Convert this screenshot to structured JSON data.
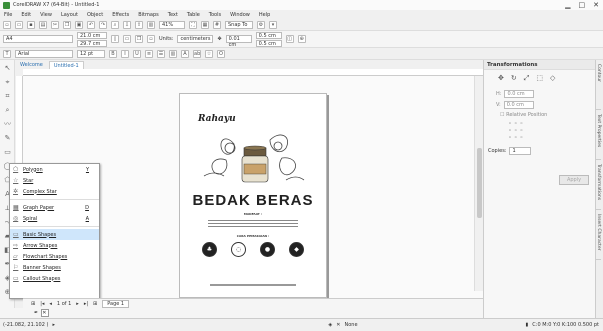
{
  "window": {
    "title": "CorelDRAW X7 (64-Bit) - Untitled-1",
    "minimize": "▁",
    "maximize": "□",
    "close": "✕"
  },
  "menu": [
    "File",
    "Edit",
    "View",
    "Layout",
    "Object",
    "Effects",
    "Bitmaps",
    "Text",
    "Table",
    "Tools",
    "Window",
    "Help"
  ],
  "toolbar": {
    "zoom": "41%",
    "snap_to": "Snap To"
  },
  "propbar": {
    "paper": "A4",
    "width": "21.0 cm",
    "height": "29.7 cm",
    "units_label": "Units:",
    "units": "centimeters",
    "nudge": "0.01 cm",
    "dup_x": "0.5 cm",
    "dup_y": "0.5 cm"
  },
  "textbar": {
    "font": "Arial",
    "size": "12 pt"
  },
  "tabs": {
    "welcome": "Welcome",
    "doc": "Untitled-1"
  },
  "flyout": {
    "items": [
      {
        "label": "Polygon",
        "key": "Y",
        "icon": "⬠"
      },
      {
        "label": "Star",
        "key": "",
        "icon": "☆"
      },
      {
        "label": "Complex Star",
        "key": "",
        "icon": "✲"
      },
      {
        "label": "Graph Paper",
        "key": "D",
        "icon": "▦"
      },
      {
        "label": "Spiral",
        "key": "A",
        "icon": "◎"
      },
      {
        "label": "Basic Shapes",
        "key": "",
        "icon": "▭"
      },
      {
        "label": "Arrow Shapes",
        "key": "",
        "icon": "⇨"
      },
      {
        "label": "Flowchart Shapes",
        "key": "",
        "icon": "▱"
      },
      {
        "label": "Banner Shapes",
        "key": "",
        "icon": "⚐"
      },
      {
        "label": "Callout Shapes",
        "key": "",
        "icon": "▭"
      }
    ]
  },
  "document": {
    "brand": "Rahayu",
    "title": "BEDAK BERAS",
    "subhead": "MANFAAT :",
    "section": "CARA PEMAKAIAN :",
    "circles": [
      "♣",
      "◌",
      "●",
      "◆"
    ]
  },
  "pagebar": {
    "page_count": "1 of 1",
    "page_tab": "Page 1"
  },
  "status": {
    "coords": "(-21.082, 21.102 )",
    "fill": "None",
    "color_profile": "C:0 M:0 Y:0 K:100 0.500 pt"
  },
  "docker": {
    "title": "Transformations",
    "x": "0.0 cm",
    "y": "0.0 cm",
    "relative_position": "Relative Position",
    "copies_label": "Copies:",
    "copies": "1",
    "apply": "Apply"
  },
  "sidetabs": [
    "Contour",
    "Text Properties",
    "Transformations",
    "Insert Character"
  ],
  "colors": {
    "accent": "#2a6fb0",
    "selection": "#cfe6fb",
    "app_icon": "#3a8f3a"
  }
}
